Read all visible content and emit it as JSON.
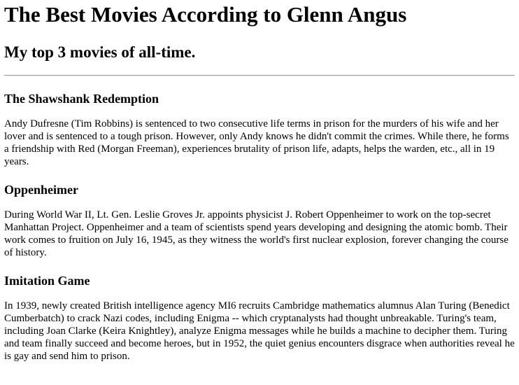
{
  "page": {
    "title": "The Best Movies According to Glenn Angus",
    "subtitle": "My top 3 movies of all-time."
  },
  "movies": [
    {
      "title": "The Shawshank Redemption",
      "description": "Andy Dufresne (Tim Robbins) is sentenced to two consecutive life terms in prison for the murders of his wife and her lover and is sentenced to a tough prison. However, only Andy knows he didn't commit the crimes. While there, he forms a friendship with Red (Morgan Freeman), experiences brutality of prison life, adapts, helps the warden, etc., all in 19 years."
    },
    {
      "title": "Oppenheimer",
      "description": "During World War II, Lt. Gen. Leslie Groves Jr. appoints physicist J. Robert Oppenheimer to work on the top-secret Manhattan Project. Oppenheimer and a team of scientists spend years developing and designing the atomic bomb. Their work comes to fruition on July 16, 1945, as they witness the world's first nuclear explosion, forever changing the course of history."
    },
    {
      "title": "Imitation Game",
      "description": "In 1939, newly created British intelligence agency MI6 recruits Cambridge mathematics alumnus Alan Turing (Benedict Cumberbatch) to crack Nazi codes, including Enigma -- which cryptanalysts had thought unbreakable. Turing's team, including Joan Clarke (Keira Knightley), analyze Enigma messages while he builds a machine to decipher them. Turing and team finally succeed and become heroes, but in 1952, the quiet genius encounters disgrace when authorities reveal he is gay and send him to prison."
    }
  ]
}
